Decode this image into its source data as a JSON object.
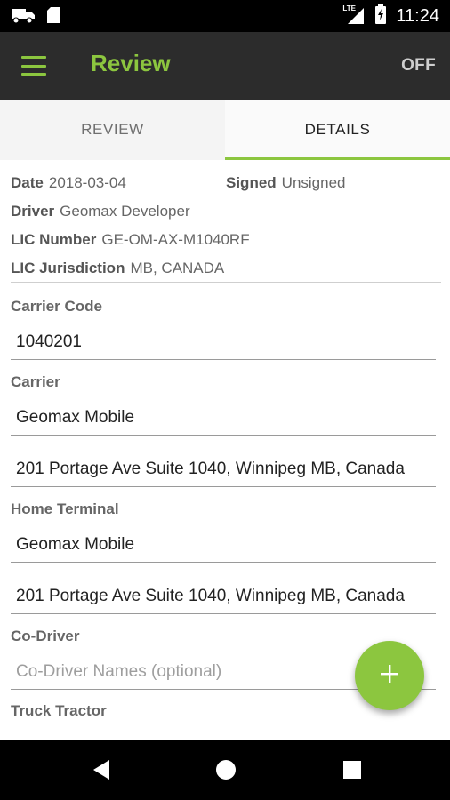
{
  "status_bar": {
    "time": "11:24",
    "network": "LTE",
    "icons": [
      "truck-icon",
      "sd-card-icon",
      "signal-icon",
      "battery-charging-icon"
    ]
  },
  "app_bar": {
    "title": "Review",
    "off_label": "OFF",
    "menu_icon": "hamburger-menu-icon"
  },
  "tabs": [
    {
      "label": "REVIEW",
      "active": false
    },
    {
      "label": "DETAILS",
      "active": true
    }
  ],
  "info": {
    "date_label": "Date",
    "date_value": "2018-03-04",
    "signed_label": "Signed",
    "signed_value": "Unsigned",
    "driver_label": "Driver",
    "driver_value": "Geomax Developer",
    "lic_number_label": "LIC Number",
    "lic_number_value": "GE-OM-AX-M1040RF",
    "lic_jurisdiction_label": "LIC Jurisdiction",
    "lic_jurisdiction_value": "MB, CANADA"
  },
  "form": {
    "carrier_code_label": "Carrier Code",
    "carrier_code_value": "1040201",
    "carrier_label": "Carrier",
    "carrier_name": "Geomax Mobile",
    "carrier_address": "201 Portage Ave Suite 1040, Winnipeg MB, Canada",
    "home_terminal_label": "Home Terminal",
    "home_terminal_name": "Geomax Mobile",
    "home_terminal_address": "201 Portage Ave Suite 1040, Winnipeg MB, Canada",
    "co_driver_label": "Co-Driver",
    "co_driver_placeholder": "Co-Driver Names (optional)",
    "truck_tractor_label": "Truck Tractor"
  },
  "fab": {
    "icon": "plus-icon"
  },
  "nav_bar": {
    "icons": [
      "back-icon",
      "home-icon",
      "recents-icon"
    ]
  },
  "colors": {
    "accent": "#8cc63f",
    "app_bar": "#2c2c2c",
    "status_bar": "#000000"
  }
}
